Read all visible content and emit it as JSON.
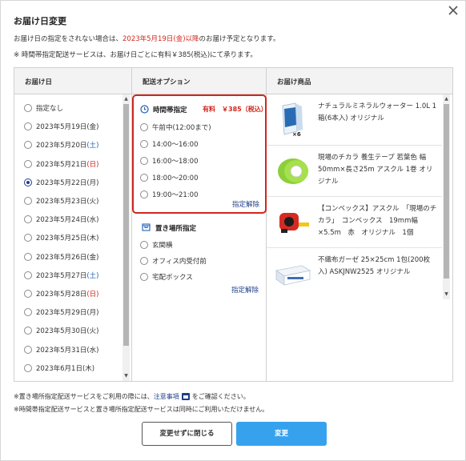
{
  "dialog": {
    "title": "お届け日変更",
    "info_prefix": "お届け日の指定をされない場合は、",
    "info_date": "2023年5月19日(金)以降",
    "info_suffix": "のお届け予定となります。",
    "info2": "※ 時間帯指定配送サービスは、お届け日ごとに有料￥385(税込)にて承ります。"
  },
  "columns": {
    "date_header": "お届け日",
    "option_header": "配送オプション",
    "product_header": "お届け商品"
  },
  "dates": [
    {
      "label": "指定なし",
      "type": "normal",
      "selected": false
    },
    {
      "label": "2023年5月19日",
      "weekday": "(金)",
      "type": "normal",
      "selected": false
    },
    {
      "label": "2023年5月20日",
      "weekday": "(土)",
      "type": "sat",
      "selected": false
    },
    {
      "label": "2023年5月21日",
      "weekday": "(日)",
      "type": "sun",
      "selected": false
    },
    {
      "label": "2023年5月22日",
      "weekday": "(月)",
      "type": "normal",
      "selected": true
    },
    {
      "label": "2023年5月23日",
      "weekday": "(火)",
      "type": "normal",
      "selected": false
    },
    {
      "label": "2023年5月24日",
      "weekday": "(水)",
      "type": "normal",
      "selected": false
    },
    {
      "label": "2023年5月25日",
      "weekday": "(木)",
      "type": "normal",
      "selected": false
    },
    {
      "label": "2023年5月26日",
      "weekday": "(金)",
      "type": "normal",
      "selected": false
    },
    {
      "label": "2023年5月27日",
      "weekday": "(土)",
      "type": "sat",
      "selected": false
    },
    {
      "label": "2023年5月28日",
      "weekday": "(日)",
      "type": "sun",
      "selected": false
    },
    {
      "label": "2023年5月29日",
      "weekday": "(月)",
      "type": "normal",
      "selected": false
    },
    {
      "label": "2023年5月30日",
      "weekday": "(火)",
      "type": "normal",
      "selected": false
    },
    {
      "label": "2023年5月31日",
      "weekday": "(水)",
      "type": "normal",
      "selected": false
    },
    {
      "label": "2023年6月1日",
      "weekday": "(木)",
      "type": "normal",
      "selected": false
    }
  ],
  "time_option": {
    "title": "時間帯指定",
    "fee": "有料　￥385（税込）",
    "slots": [
      "午前中(12:00まで)",
      "14:00〜16:00",
      "16:00〜18:00",
      "18:00〜20:00",
      "19:00〜21:00"
    ],
    "clear_label": "指定解除"
  },
  "place_option": {
    "title": "置き場所指定",
    "places": [
      "玄関横",
      "オフィス内受付前",
      "宅配ボックス"
    ],
    "clear_label": "指定解除"
  },
  "products": [
    {
      "name": "ナチュラルミネラルウォーター 1.0L 1箱(6本入) オリジナル",
      "badge": "×6"
    },
    {
      "name": "現場のチカラ 養生テープ 若葉色 幅50mm×長さ25m アスクル 1巻 オリジナル"
    },
    {
      "name": "【コンベックス】アスクル　「現場のチカラ」　コンベックス　19mm幅×5.5m　赤　オリジナル　1個"
    },
    {
      "name": "不織布ガーゼ 25×25cm 1包(200枚入) ASKJNW2525 オリジナル"
    }
  ],
  "footer": {
    "note1_prefix": "※置き場所指定配送サービスをご利用の際には、",
    "note1_link": "注意事項",
    "note1_suffix": "をご確認ください。",
    "note2": "※時間帯指定配送サービスと置き場所指定配送サービスは同時にご利用いただけません。"
  },
  "buttons": {
    "cancel": "変更せずに閉じる",
    "submit": "変更"
  },
  "colors": {
    "accent_red": "#d0271d",
    "link_blue": "#1f3f86",
    "submit_blue": "#36a2ee",
    "saturday": "#1f5fb4"
  }
}
